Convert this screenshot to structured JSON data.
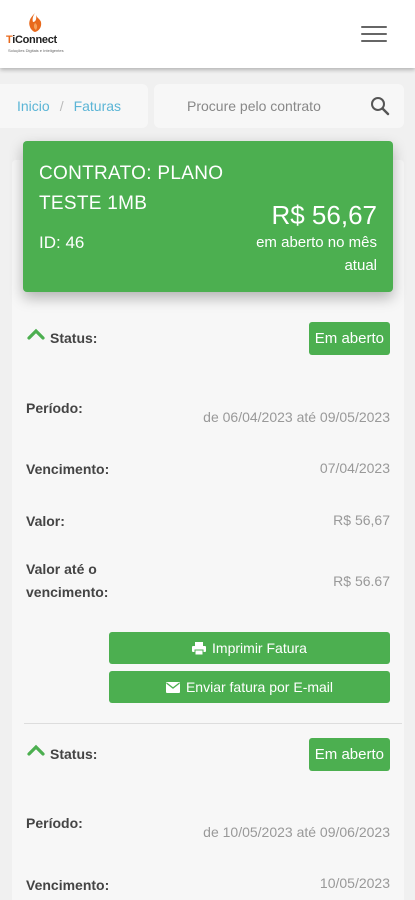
{
  "header": {
    "logo_text_orange": "T",
    "logo_text_rest": "iConnect",
    "logo_tagline": "Soluções Digitais e Inteligentes",
    "menu_icon": "hamburger-icon"
  },
  "breadcrumb": {
    "home": "Inicio",
    "separator": "/",
    "current": "Faturas"
  },
  "search": {
    "placeholder": "Procure pelo contrato",
    "value": "",
    "icon": "search-icon"
  },
  "contract": {
    "name": "CONTRATO: PLANO TESTE 1MB",
    "id_label": "ID: 46",
    "amount": "R$ 56,67",
    "amount_caption": "em aberto no mês atual"
  },
  "invoices": [
    {
      "status_label": "Status:",
      "status": "Em aberto",
      "period_label": "Período:",
      "period": "de 06/04/2023 até 09/05/2023",
      "due_label": "Vencimento:",
      "due": "07/04/2023",
      "value_label": "Valor:",
      "value": "R$ 56,67",
      "value_until_due_label_1": "Valor até o",
      "value_until_due_label_2": "vencimento:",
      "value_until_due": "R$ 56.67",
      "print_button": "Imprimir Fatura",
      "email_button": "Enviar fatura por E-mail"
    },
    {
      "status_label": "Status:",
      "status": "Em aberto",
      "period_label": "Período:",
      "period": "de 10/05/2023 até 09/06/2023",
      "due_label": "Vencimento:",
      "due": "10/05/2023"
    }
  ],
  "colors": {
    "primary_green": "#4caf50",
    "link_blue": "#5bb5d6",
    "brand_orange": "#e8691c"
  }
}
